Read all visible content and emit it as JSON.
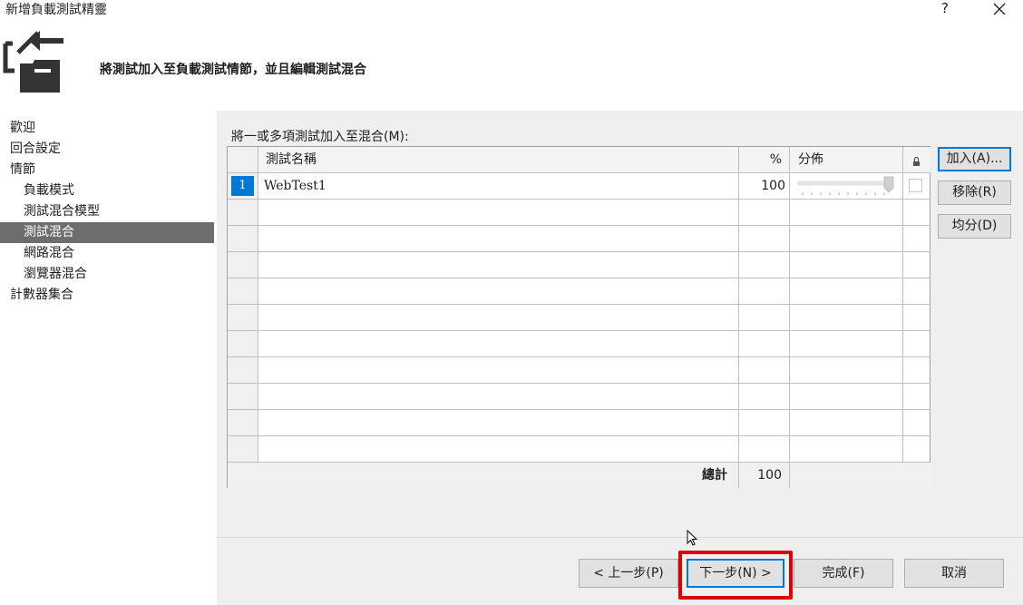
{
  "window": {
    "title": "新增負載測試精靈",
    "help_label": "?",
    "close_label": "✕"
  },
  "header": {
    "icon": "add-test-mix-icon",
    "text": "將測試加入至負載測試情節，並且編輯測試混合"
  },
  "nav": {
    "items": [
      {
        "label": "歡迎",
        "level": 0,
        "selected": false
      },
      {
        "label": "回合設定",
        "level": 0,
        "selected": false
      },
      {
        "label": "情節",
        "level": 0,
        "selected": false
      },
      {
        "label": "負載模式",
        "level": 1,
        "selected": false
      },
      {
        "label": "測試混合模型",
        "level": 1,
        "selected": false
      },
      {
        "label": "測試混合",
        "level": 1,
        "selected": true
      },
      {
        "label": "網路混合",
        "level": 1,
        "selected": false
      },
      {
        "label": "瀏覽器混合",
        "level": 1,
        "selected": false
      },
      {
        "label": "計數器集合",
        "level": 0,
        "selected": false
      }
    ]
  },
  "grid": {
    "label": "將一或多項測試加入至混合(M):",
    "columns": {
      "name": "測試名稱",
      "percent": "%",
      "distribution": "分佈",
      "lock_icon": "lock-icon"
    },
    "rows": [
      {
        "index": "1",
        "name": "WebTest1",
        "percent": "100",
        "slider_value_pct": 100,
        "locked": false
      }
    ],
    "empty_row_count": 10,
    "total_label": "總計",
    "total_value": "100"
  },
  "side_buttons": {
    "add": "加入(A)...",
    "remove": "移除(R)",
    "distribute": "均分(D)"
  },
  "footer": {
    "back": "< 上一步(P)",
    "next": "下一步(N) >",
    "finish": "完成(F)",
    "cancel": "取消"
  },
  "colors": {
    "accent": "#0078d7",
    "nav_selected": "#6d6d6d",
    "highlight": "#e00000",
    "content_bg": "#efefef"
  }
}
